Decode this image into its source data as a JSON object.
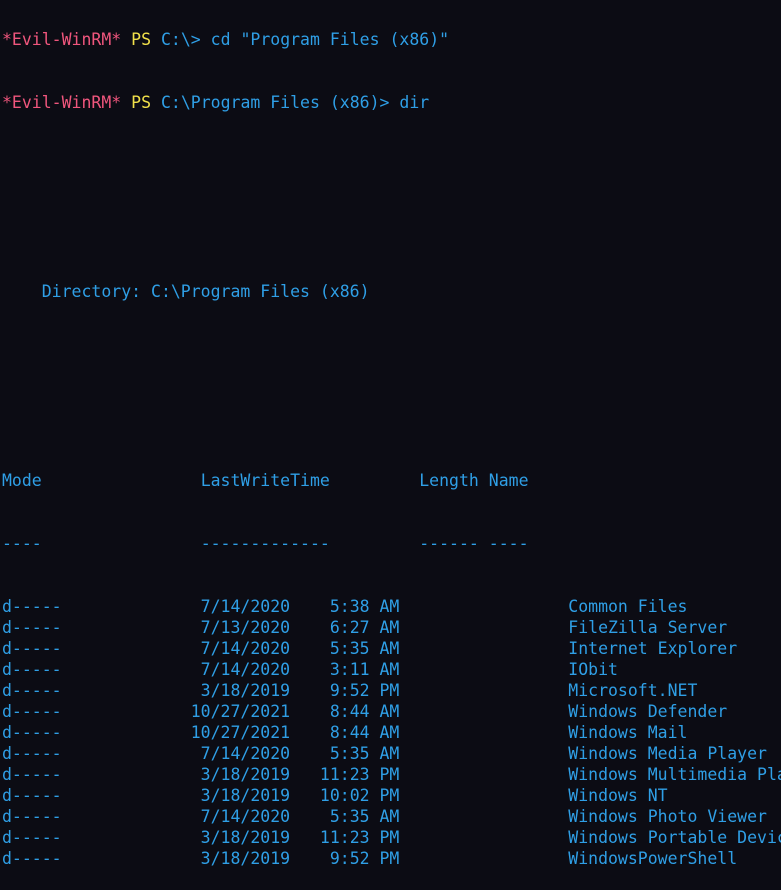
{
  "terminal": {
    "prompt_prev": {
      "name": "*Evil-WinRM*",
      "ps": "PS",
      "path": "C:\\>",
      "command": "cd \"Program Files (x86)\""
    },
    "prompt": {
      "name": "*Evil-WinRM*",
      "ps": "PS",
      "path": "C:\\Program Files (x86)>",
      "command": "dir"
    },
    "directory_label": "    Directory: C:\\Program Files (x86)",
    "columns": {
      "mode": "Mode",
      "lastwritetime": "LastWriteTime",
      "length": "Length",
      "name": "Name"
    },
    "separators": {
      "mode": "----",
      "lastwritetime": "-------------",
      "length": "------",
      "name": "----"
    },
    "rows": [
      {
        "mode": "d-----",
        "date": "7/14/2020",
        "time": "5:38 AM",
        "length": "",
        "name": "Common Files"
      },
      {
        "mode": "d-----",
        "date": "7/13/2020",
        "time": "6:27 AM",
        "length": "",
        "name": "FileZilla Server"
      },
      {
        "mode": "d-----",
        "date": "7/14/2020",
        "time": "5:35 AM",
        "length": "",
        "name": "Internet Explorer"
      },
      {
        "mode": "d-----",
        "date": "7/14/2020",
        "time": "3:11 AM",
        "length": "",
        "name": "IObit"
      },
      {
        "mode": "d-----",
        "date": "3/18/2019",
        "time": "9:52 PM",
        "length": "",
        "name": "Microsoft.NET"
      },
      {
        "mode": "d-----",
        "date": "10/27/2021",
        "time": "8:44 AM",
        "length": "",
        "name": "Windows Defender"
      },
      {
        "mode": "d-----",
        "date": "10/27/2021",
        "time": "8:44 AM",
        "length": "",
        "name": "Windows Mail"
      },
      {
        "mode": "d-----",
        "date": "7/14/2020",
        "time": "5:35 AM",
        "length": "",
        "name": "Windows Media Player"
      },
      {
        "mode": "d-----",
        "date": "3/18/2019",
        "time": "11:23 PM",
        "length": "",
        "name": "Windows Multimedia Platform"
      },
      {
        "mode": "d-----",
        "date": "3/18/2019",
        "time": "10:02 PM",
        "length": "",
        "name": "Windows NT"
      },
      {
        "mode": "d-----",
        "date": "7/14/2020",
        "time": "5:35 AM",
        "length": "",
        "name": "Windows Photo Viewer"
      },
      {
        "mode": "d-----",
        "date": "3/18/2019",
        "time": "11:23 PM",
        "length": "",
        "name": "Windows Portable Devices"
      },
      {
        "mode": "d-----",
        "date": "3/18/2019",
        "time": "9:52 PM",
        "length": "",
        "name": "WindowsPowerShell"
      }
    ],
    "colors": {
      "background": "#0c0c14",
      "text": "#2f9fe6",
      "prompt_name": "#f0567d",
      "prompt_ps": "#f2e14a"
    }
  }
}
